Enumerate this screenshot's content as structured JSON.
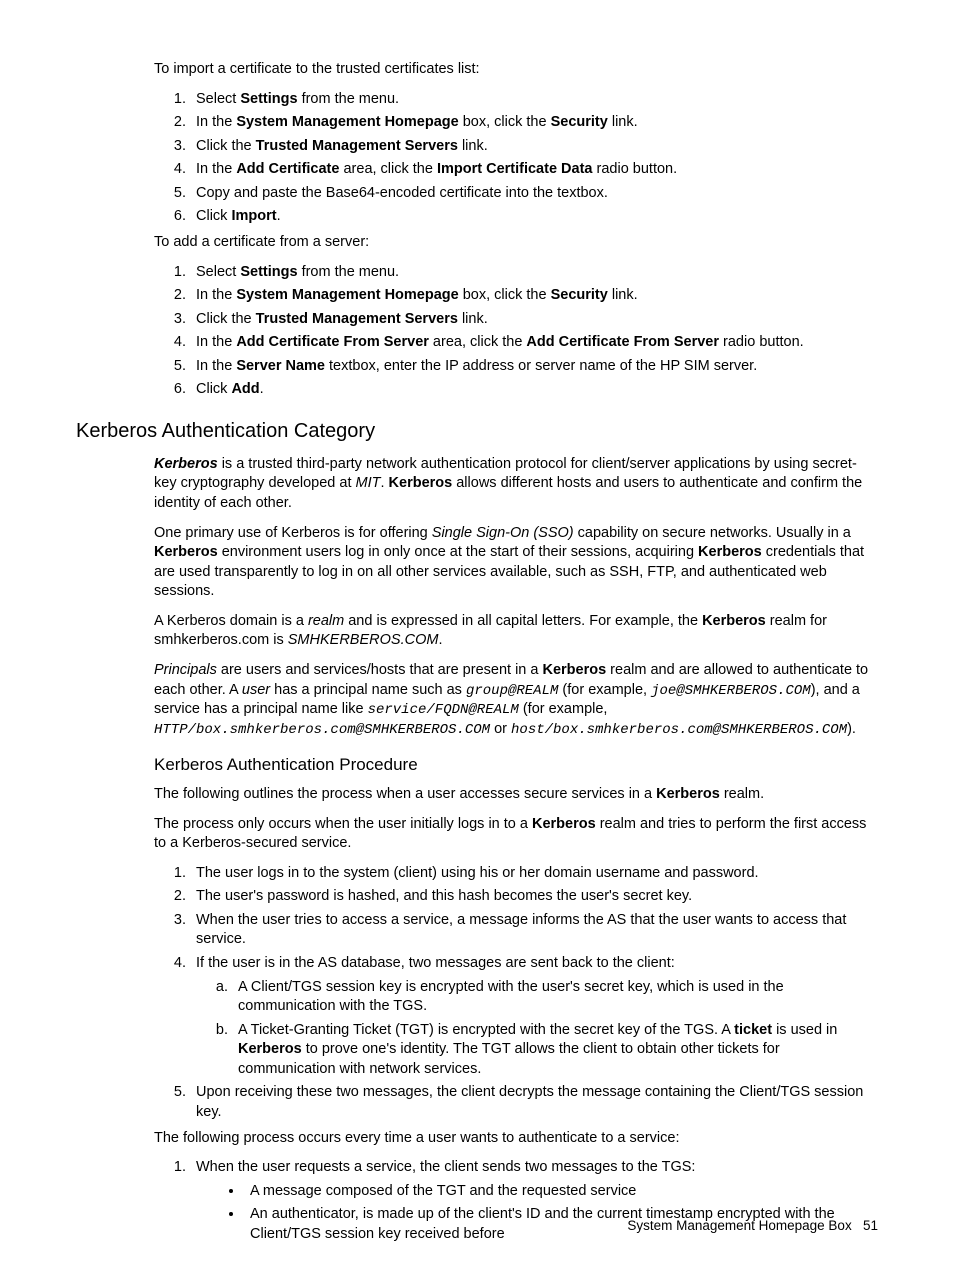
{
  "intro1": "To import a certificate to the trusted certificates list:",
  "list1": {
    "i1_a": "Select ",
    "i1_b": "Settings",
    "i1_c": " from the menu.",
    "i2_a": "In the ",
    "i2_b": "System Management Homepage",
    "i2_c": " box, click the ",
    "i2_d": "Security",
    "i2_e": " link.",
    "i3_a": "Click the ",
    "i3_b": "Trusted Management Servers",
    "i3_c": " link.",
    "i4_a": "In the ",
    "i4_b": "Add Certificate",
    "i4_c": " area, click the ",
    "i4_d": "Import Certificate Data",
    "i4_e": " radio button.",
    "i5": "Copy and paste the Base64-encoded certificate into the textbox.",
    "i6_a": "Click ",
    "i6_b": "Import",
    "i6_c": "."
  },
  "intro2": "To add a certificate from a server:",
  "list2": {
    "i1_a": "Select ",
    "i1_b": "Settings",
    "i1_c": " from the menu.",
    "i2_a": "In the ",
    "i2_b": "System Management Homepage",
    "i2_c": " box, click the ",
    "i2_d": "Security",
    "i2_e": " link.",
    "i3_a": "Click the ",
    "i3_b": "Trusted Management Servers",
    "i3_c": " link.",
    "i4_a": "In the ",
    "i4_b": "Add Certificate From Server",
    "i4_c": " area, click the ",
    "i4_d": "Add Certificate From Server",
    "i4_e": " radio button.",
    "i5_a": "In the ",
    "i5_b": "Server Name",
    "i5_c": " textbox, enter the IP address or server name of the HP SIM server.",
    "i6_a": "Click ",
    "i6_b": "Add",
    "i6_c": "."
  },
  "heading_kac": "Kerberos Authentication Category",
  "kac_p1": {
    "a": "Kerberos",
    "b": " is a trusted third-party network authentication protocol for client/server applications by using secret-key cryptography developed at ",
    "c": "MIT",
    "d": ". ",
    "e": "Kerberos",
    "f": " allows different hosts and users to authenticate and confirm the identity of each other."
  },
  "kac_p2": {
    "a": "One primary use of Kerberos is for offering ",
    "b": "Single Sign-On (SSO)",
    "c": " capability on secure networks. Usually in a ",
    "d": "Kerberos",
    "e": " environment users log in only once at the start of their sessions, acquiring ",
    "f": "Kerberos",
    "g": " credentials that are used transparently to log in on all other services available, such as SSH, FTP, and authenticated web sessions."
  },
  "kac_p3": {
    "a": "A Kerberos domain is a ",
    "b": "realm",
    "c": " and is expressed in all capital letters. For example, the ",
    "d": "Kerberos",
    "e": " realm for smhkerberos.com is ",
    "f": "SMHKERBEROS.COM",
    "g": "."
  },
  "kac_p4": {
    "a": "Principals",
    "b": " are users and services/hosts that are present in a ",
    "c": "Kerberos",
    "d": " realm and are allowed to authenticate to each other. A ",
    "e": "user",
    "f": " has a principal name such as ",
    "g": "group@REALM",
    "h": " (for example, ",
    "i": "joe@SMHKERBEROS.COM",
    "j": "), and a service has a principal name like ",
    "k": "service/FQDN@REALM",
    "l": " (for example, ",
    "m": "HTTP/box.smhkerberos.com@SMHKERBEROS.COM",
    "n": " or ",
    "o": "host/box.smhkerberos.com@SMHKERBEROS.COM",
    "p": ")."
  },
  "heading_kap": "Kerberos Authentication Procedure",
  "kap_p1": {
    "a": "The following outlines the process when a user accesses secure services in a ",
    "b": "Kerberos",
    "c": " realm."
  },
  "kap_p2": {
    "a": "The process only occurs when the user initially logs in to a ",
    "b": "Kerberos",
    "c": " realm and tries to perform the first access to a Kerberos-secured service."
  },
  "list3": {
    "i1": "The user logs in to the system (client) using his or her domain username and password.",
    "i2": "The user's password is hashed, and this hash becomes the user's secret key.",
    "i3": "When the user tries to access a service, a message informs the AS that the user wants to access that service.",
    "i4": "If the user is in the AS database, two messages are sent back to the client:",
    "i4a": "A Client/TGS session key is encrypted with the user's secret key, which is used in the communication with the TGS.",
    "i4b_a": "A Ticket-Granting Ticket (TGT) is encrypted with the secret key of the TGS. A ",
    "i4b_b": "ticket",
    "i4b_c": " is used in ",
    "i4b_d": "Kerberos",
    "i4b_e": " to prove one's identity. The TGT allows the client to obtain other tickets for communication with network services.",
    "i5": "Upon receiving these two messages, the client decrypts the message containing the Client/TGS session key."
  },
  "kap_p3": "The following process occurs every time a user wants to authenticate to a service:",
  "list4": {
    "i1": "When the user requests a service, the client sends two messages to the TGS:",
    "b1": "A message composed of the TGT and the requested service",
    "b2": "An authenticator, is made up of the client's ID and the current timestamp encrypted with the Client/TGS session key received before"
  },
  "footer": {
    "text": "System Management Homepage Box",
    "page": "51"
  }
}
